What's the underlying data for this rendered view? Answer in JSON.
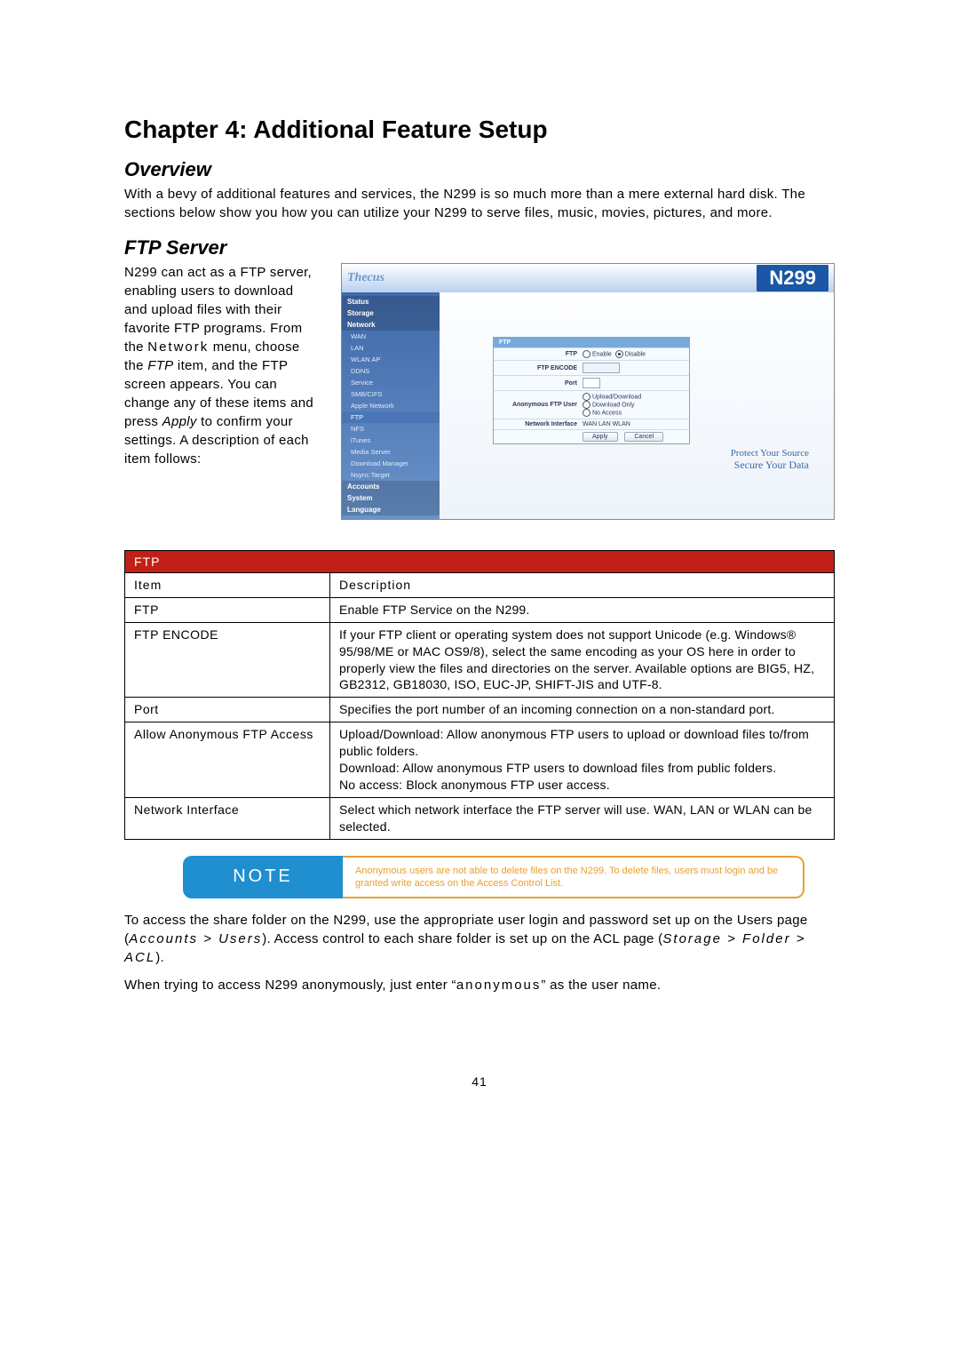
{
  "chapter_title": "Chapter 4: Additional Feature Setup",
  "overview": {
    "heading": "Overview",
    "text": "With a bevy of additional features and services, the N299 is so much more than a mere external hard disk. The sections below show you how you can utilize your N299 to serve files, music, movies, pictures, and more."
  },
  "ftp": {
    "heading": "FTP Server",
    "para_1": "N299 can act as a FTP server, enabling users to download and upload files with their favorite FTP programs. From the ",
    "para_net": "Network",
    "para_2": " menu, choose the ",
    "para_ftp": "FTP",
    "para_3": " item, and the FTP screen appears. You can change any of these items and press ",
    "para_apply": "Apply",
    "para_4": " to confirm your settings. A description of each item follows:"
  },
  "screenshot": {
    "logo": "Thecus",
    "model": "N299",
    "sidebar": {
      "cats": [
        "Status",
        "Storage",
        "Network",
        "Accounts",
        "System",
        "Language"
      ],
      "net_items": [
        "WAN",
        "LAN",
        "WLAN AP",
        "DDNS",
        "Service",
        "SMB/CIFS",
        "Apple Network",
        "FTP",
        "NFS",
        "iTunes",
        "Media Server",
        "Download Manager",
        "Nsync Target"
      ]
    },
    "panel": {
      "title": "FTP",
      "rows": {
        "ftp_label": "FTP",
        "enable": "Enable",
        "disable": "Disable",
        "encode_label": "FTP ENCODE",
        "port_label": "Port",
        "anon_label": "Anonymous FTP User",
        "anon_opt1": "Upload/Download",
        "anon_opt2": "Download Only",
        "anon_opt3": "No Access",
        "iface_label": "Network Interface",
        "iface_opt": "WAN   LAN   WLAN",
        "apply": "Apply",
        "cancel": "Cancel"
      }
    },
    "footer1": "Protect Your Source",
    "footer2": "Secure Your Data"
  },
  "table": {
    "header": "FTP",
    "h_item": "Item",
    "h_desc": "Description",
    "rows": [
      {
        "k": "FTP",
        "v": "Enable FTP Service on the N299."
      },
      {
        "k": "FTP ENCODE",
        "v": "If your FTP client or operating system does not support Unicode (e.g. Windows® 95/98/ME or MAC OS9/8), select the same encoding as your OS here in order to properly view the files and directories on the server. Available options are BIG5, HZ, GB2312, GB18030, ISO, EUC-JP, SHIFT-JIS and UTF-8."
      },
      {
        "k": "Port",
        "v": "Specifies the port number of an incoming connection on a non-standard port."
      },
      {
        "k": "Allow Anonymous FTP Access",
        "v": "Upload/Download: Allow anonymous FTP users to upload or download files to/from public folders.\nDownload: Allow anonymous FTP users to download files from public folders.\nNo access: Block anonymous FTP user access."
      },
      {
        "k": "Network Interface",
        "v": "Select which network interface the FTP server will use. WAN, LAN or WLAN can be selected."
      }
    ]
  },
  "note": {
    "label": "NOTE",
    "text": "Anonymous users are not able to delete files on the N299. To delete files, users must login and be granted write access on the Access Control List."
  },
  "after_note": {
    "p1a": "To access the share folder on the N299, use the appropriate user login and password set up on the Users page (",
    "p1b": "Accounts > Users",
    "p1c": "). Access control to each share folder is set up on the ACL page (",
    "p1d": "Storage > Folder > ACL",
    "p1e": ").",
    "p2a": "When trying to access N299 anonymously, just enter “",
    "p2b": "anonymous",
    "p2c": "” as the user name."
  },
  "page_number": "41"
}
